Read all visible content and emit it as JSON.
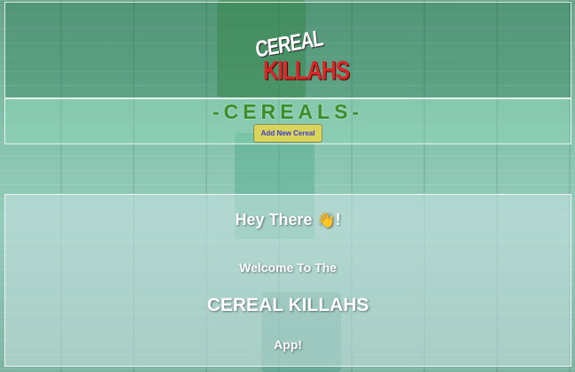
{
  "header": {
    "logo_line1": "CEREAL",
    "logo_line2": "KILLAHS"
  },
  "cereals_bar": {
    "title": "-CEREALS-",
    "add_button_label": "Add New Cereal"
  },
  "welcome": {
    "greeting": "Hey There",
    "greeting_emoji": "👋",
    "greeting_end": "!",
    "line1": "Welcome To The",
    "app_name": "CEREAL KILLAHS",
    "line3": "App!"
  },
  "colors": {
    "accent_green": "#3a8f2a",
    "logo_red": "#d62828",
    "button_yellow": "#d9d45a",
    "button_text": "#3b3bd6"
  }
}
